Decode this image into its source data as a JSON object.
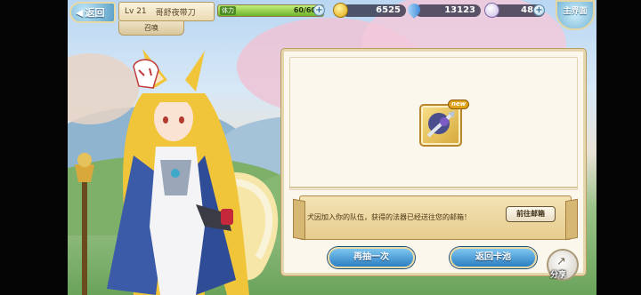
{
  "topbar": {
    "back_label": "返回",
    "player_level": "Lv 21",
    "player_name": "哥舒夜带刀",
    "summon_tab": "召唤",
    "stamina_label": "体力",
    "stamina_value": "60/60",
    "stamina_fraction": 1.0,
    "gold": "6525",
    "diamonds": "13123",
    "tickets": "484",
    "home_label": "主界面"
  },
  "result": {
    "new_badge": "new",
    "message": "犬因加入你的队伍，获得的法器已经送往您的邮箱！",
    "mailbox_button": "前往邮箱",
    "draw_again_button": "再抽一次",
    "back_to_pool_button": "返回卡池",
    "share_label": "分享"
  },
  "colors": {
    "button_blue": "#2c7fc2",
    "panel_bg": "#fbf7ec",
    "banner_gold": "#e6cc8e",
    "stamina_green": "#6fb32a"
  }
}
